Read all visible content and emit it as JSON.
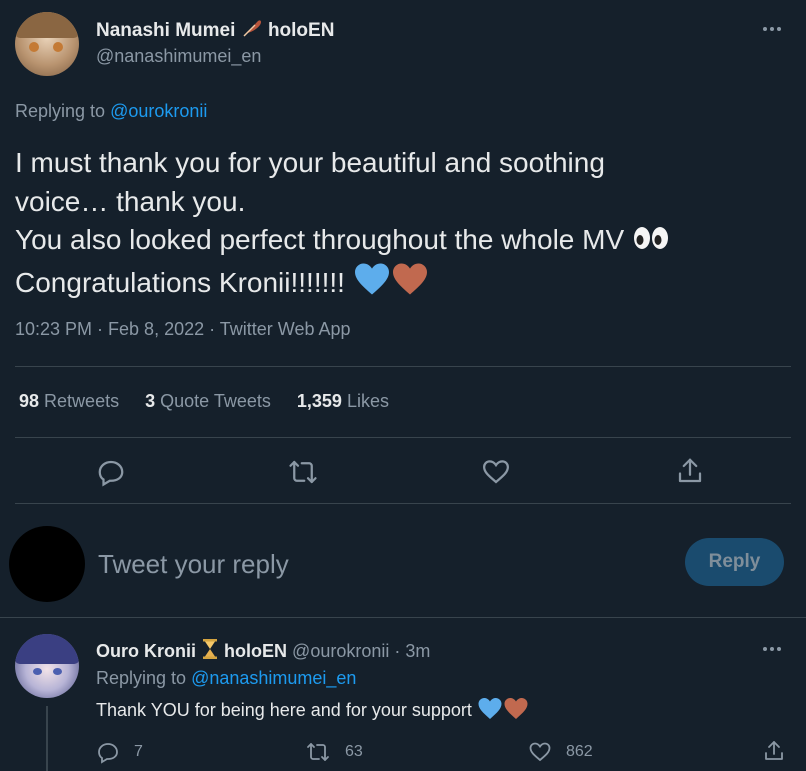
{
  "main_tweet": {
    "author_name": "Nanashi Mumei",
    "author_affiliation": "holoEN",
    "author_handle": "@nanashimumei_en",
    "replying_to_label": "Replying to",
    "replying_to_handle": "@ourokronii",
    "text_line1": "I must thank you for your beautiful and soothing",
    "text_line2": "voice… thank you.",
    "text_line3": "You also looked perfect throughout the whole MV",
    "text_line4": "Congratulations Kronii!!!!!!!",
    "timestamp": "10:23 PM · Feb 8, 2022 · Twitter Web App",
    "retweets_count": "98",
    "retweets_label": "Retweets",
    "quote_count": "3",
    "quote_label": "Quote Tweets",
    "likes_count": "1,359",
    "likes_label": "Likes"
  },
  "composer": {
    "placeholder": "Tweet your reply",
    "reply_button": "Reply"
  },
  "reply_tweet": {
    "author_name": "Ouro Kronii",
    "author_affiliation": "holoEN",
    "author_handle": "@ourokronii",
    "age": "· 3m",
    "replying_to_label": "Replying to",
    "replying_to_handle": "@nanashimumei_en",
    "text": "Thank YOU for being here and for your support",
    "reply_count": "7",
    "retweet_count": "63",
    "like_count": "862"
  },
  "colors": {
    "background": "#15202b",
    "text": "#e7e9ea",
    "muted": "#8b98a5",
    "accent": "#1d9bf0",
    "reply_button_bg": "#1a4b6e",
    "divider": "#38444d",
    "blue_heart": "#5dadec",
    "brown_heart": "#c1694f"
  },
  "icons": [
    "more-icon",
    "feather-icon",
    "hourglass-icon",
    "eyes-emoji",
    "blue-heart-emoji",
    "brown-heart-emoji",
    "reply-icon",
    "retweet-icon",
    "like-icon",
    "share-icon"
  ]
}
